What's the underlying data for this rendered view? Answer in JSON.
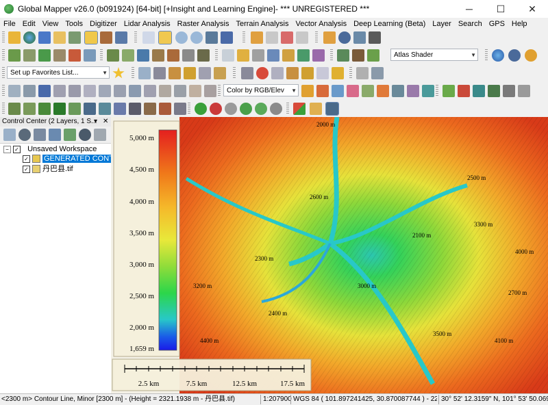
{
  "window": {
    "title": "Global Mapper v26.0 (b091924) [64-bit] [+Insight and Learning Engine]- *** UNREGISTERED ***",
    "minimize": "─",
    "maximize": "☐",
    "close": "✕"
  },
  "menu": [
    "File",
    "Edit",
    "View",
    "Tools",
    "Digitizer",
    "Lidar Analysis",
    "Raster Analysis",
    "Terrain Analysis",
    "Vector Analysis",
    "Deep Learning (Beta)",
    "Layer",
    "Search",
    "GPS",
    "Help"
  ],
  "toolbar": {
    "shader_select": "Atlas Shader",
    "favorites_select": "Set up Favorites List...",
    "color_select": "Color by RGB/Elev"
  },
  "control_center": {
    "title": "Control Center (2 Layers, 1 S...",
    "workspace": "Unsaved Workspace",
    "layers": [
      {
        "name": "GENERATED CONTOURS",
        "checked": true,
        "selected": true
      },
      {
        "name": "丹巴县.tif",
        "checked": true,
        "selected": false
      }
    ]
  },
  "legend": {
    "labels": [
      "5,000 m",
      "4,500 m",
      "4,000 m",
      "3,500 m",
      "3,000 m",
      "2,500 m",
      "2,000 m",
      "1,659 m"
    ],
    "colors": [
      "#e41f1f",
      "#f07a1a",
      "#f5b82a",
      "#e8e83a",
      "#8fdc3a",
      "#2cd64a",
      "#28c8c8",
      "#1a5ae8",
      "#1a1ae8"
    ]
  },
  "scale_bar": {
    "labels": [
      "2.5 km",
      "7.5 km",
      "12.5 km",
      "17.5 km"
    ]
  },
  "map_labels": [
    "2000 m",
    "2100 m",
    "2300 m",
    "2400 m",
    "2500 m",
    "2600 m",
    "2700 m",
    "3200 m",
    "3300 m",
    "3500 m",
    "4000 m",
    "4400 m",
    "3000 m",
    "4100 m"
  ],
  "status": {
    "layer": "<2300 m> Contour Line, Minor [2300 m] - (Height = 2321.1938 m - 丹巴县.tif)",
    "scale": "1:207900",
    "coords": "WGS 84 ( 101.897241425, 30.870087744 ) - 2274.4236 m",
    "dms": "30° 52' 12.3159\" N, 101° 53' 50.0691\" E"
  },
  "colors": {
    "title_bg": "#ffffff",
    "chrome": "#f0f0f0",
    "selection": "#0078d7"
  }
}
